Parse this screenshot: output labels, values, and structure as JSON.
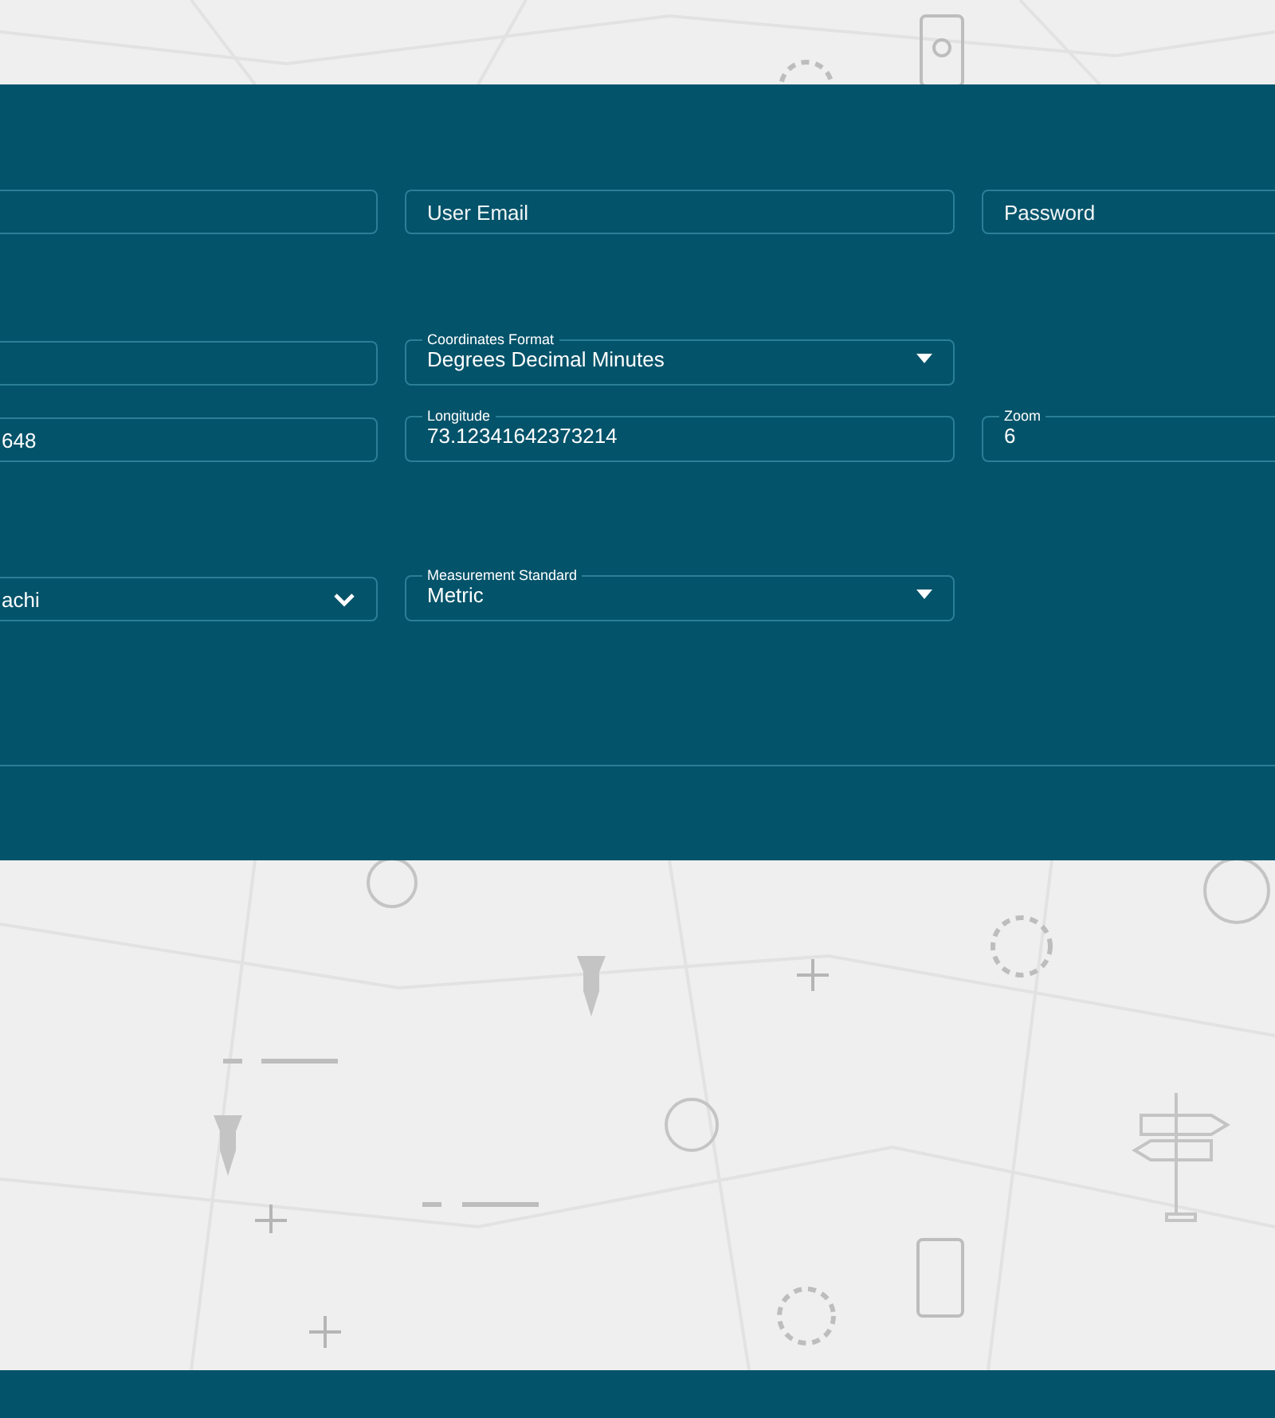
{
  "form": {
    "rows": [
      [
        {
          "kind": "text"
        },
        {
          "kind": "text",
          "placeholder": "User Email"
        },
        {
          "kind": "text",
          "placeholder": "Password"
        }
      ],
      [
        {
          "kind": "text"
        },
        {
          "kind": "select",
          "label": "Coordinates Format",
          "value": "Degrees Decimal Minutes"
        }
      ],
      [
        {
          "kind": "text",
          "value": "648"
        },
        {
          "kind": "text",
          "label": "Longitude",
          "value": "73.12341642373214"
        },
        {
          "kind": "text",
          "label": "Zoom",
          "value": "6"
        }
      ],
      [
        {
          "kind": "dropdown",
          "value": "achi"
        },
        {
          "kind": "select",
          "label": "Measurement Standard",
          "value": "Metric"
        }
      ]
    ]
  }
}
